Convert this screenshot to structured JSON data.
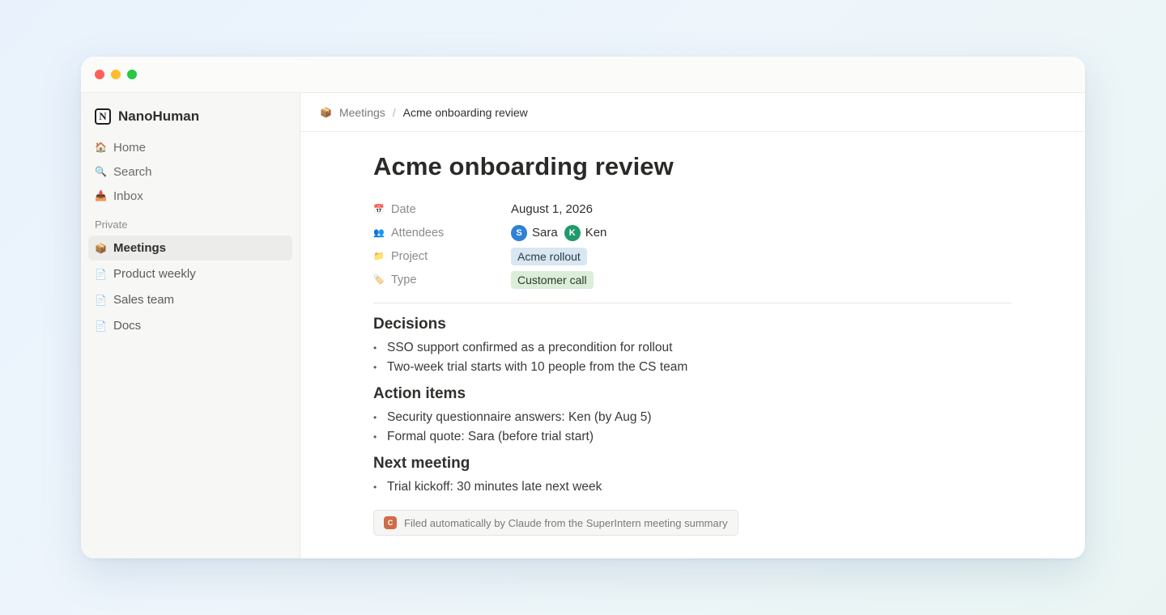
{
  "workspace": {
    "name": "NanoHuman",
    "logo_letter": "N"
  },
  "sidebar": {
    "nav": [
      {
        "icon": "home-icon",
        "label": "Home",
        "glyph": "🏠"
      },
      {
        "icon": "search-icon",
        "label": "Search",
        "glyph": "🔍"
      },
      {
        "icon": "inbox-icon",
        "label": "Inbox",
        "glyph": "📥"
      }
    ],
    "section_label": "Private",
    "pages": [
      {
        "icon": "box-icon",
        "label": "Meetings",
        "glyph": "📦",
        "active": true
      },
      {
        "icon": "page-icon",
        "label": "Product weekly",
        "glyph": "📄",
        "active": false
      },
      {
        "icon": "page-icon",
        "label": "Sales team",
        "glyph": "📄",
        "active": false
      },
      {
        "icon": "page-icon",
        "label": "Docs",
        "glyph": "📄",
        "active": false
      }
    ]
  },
  "breadcrumb": {
    "parent_icon": "📦",
    "parent": "Meetings",
    "separator": "/",
    "current": "Acme onboarding review"
  },
  "page": {
    "title": "Acme onboarding review",
    "properties": {
      "date": {
        "icon": "📅",
        "label": "Date",
        "value": "August 1, 2026"
      },
      "attendees": {
        "icon": "👥",
        "label": "Attendees",
        "people": [
          {
            "initial": "S",
            "name": "Sara",
            "color": "#2f80d6"
          },
          {
            "initial": "K",
            "name": "Ken",
            "color": "#1f9a6c"
          }
        ]
      },
      "project": {
        "icon": "📁",
        "label": "Project",
        "value": "Acme rollout",
        "color": "#d8e7f2"
      },
      "type": {
        "icon": "🏷️",
        "label": "Type",
        "value": "Customer call",
        "color": "#dbeeda"
      }
    },
    "sections": [
      {
        "heading": "Decisions",
        "items": [
          "SSO support confirmed as a precondition for rollout",
          "Two-week trial starts with 10 people from the CS team"
        ]
      },
      {
        "heading": "Action items",
        "items": [
          "Security questionnaire answers: Ken (by Aug 5)",
          "Formal quote: Sara (before trial start)"
        ]
      },
      {
        "heading": "Next meeting",
        "items": [
          "Trial kickoff: 30 minutes late next week"
        ]
      }
    ],
    "footer_note": {
      "badge": "C",
      "text": "Filed automatically by Claude from the SuperIntern meeting summary"
    }
  }
}
